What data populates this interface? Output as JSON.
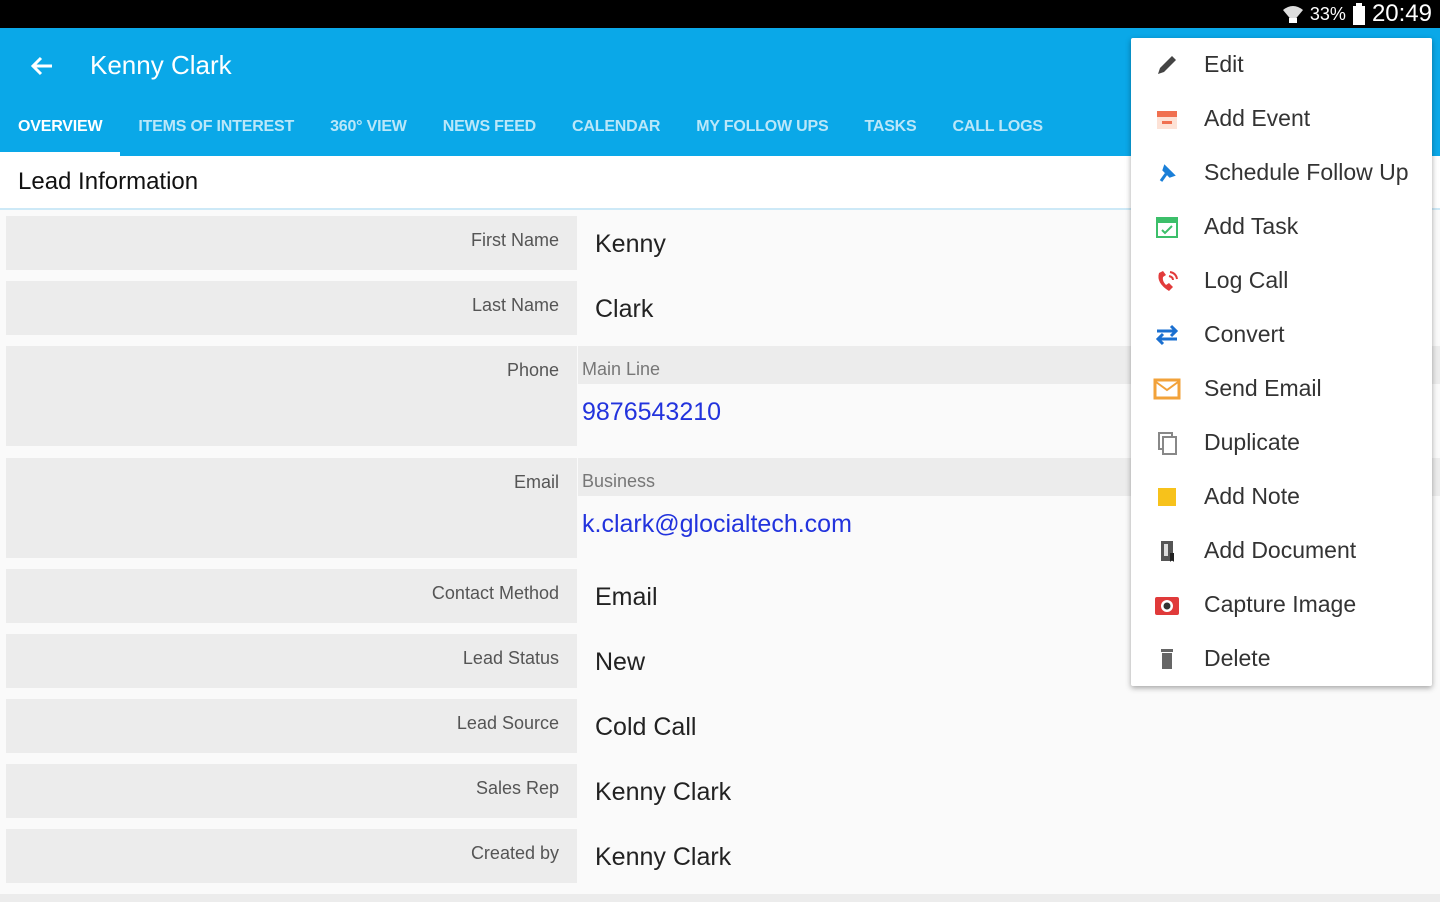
{
  "status": {
    "battery": "33%",
    "time": "20:49"
  },
  "header": {
    "title": "Kenny Clark"
  },
  "tabs": [
    {
      "label": "OVERVIEW"
    },
    {
      "label": "ITEMS OF INTEREST"
    },
    {
      "label": "360° VIEW"
    },
    {
      "label": "NEWS FEED"
    },
    {
      "label": "CALENDAR"
    },
    {
      "label": "MY FOLLOW UPS"
    },
    {
      "label": "TASKS"
    },
    {
      "label": "CALL LOGS"
    }
  ],
  "section": {
    "title": "Lead Information"
  },
  "fields": {
    "first_name": {
      "label": "First Name",
      "value": "Kenny"
    },
    "last_name": {
      "label": "Last Name",
      "value": "Clark"
    },
    "phone": {
      "label": "Phone",
      "type": "Main Line",
      "value": "9876543210"
    },
    "email": {
      "label": "Email",
      "type": "Business",
      "value": "k.clark@glocialtech.com"
    },
    "contact_method": {
      "label": "Contact Method",
      "value": "Email"
    },
    "lead_status": {
      "label": "Lead Status",
      "value": "New"
    },
    "lead_source": {
      "label": "Lead Source",
      "value": "Cold Call"
    },
    "sales_rep": {
      "label": "Sales Rep",
      "value": "Kenny Clark"
    },
    "created_by": {
      "label": "Created by",
      "value": "Kenny Clark"
    }
  },
  "menu": [
    {
      "label": "Edit",
      "icon": "pencil-icon"
    },
    {
      "label": "Add Event",
      "icon": "calendar-icon"
    },
    {
      "label": "Schedule Follow Up",
      "icon": "pin-icon"
    },
    {
      "label": "Add Task",
      "icon": "task-icon"
    },
    {
      "label": "Log Call",
      "icon": "phone-icon"
    },
    {
      "label": "Convert",
      "icon": "convert-icon"
    },
    {
      "label": "Send Email",
      "icon": "envelope-icon"
    },
    {
      "label": "Duplicate",
      "icon": "duplicate-icon"
    },
    {
      "label": "Add Note",
      "icon": "note-icon"
    },
    {
      "label": "Add Document",
      "icon": "document-icon"
    },
    {
      "label": "Capture Image",
      "icon": "camera-icon"
    },
    {
      "label": "Delete",
      "icon": "trash-icon"
    }
  ],
  "colors": {
    "primary": "#0aa8e8",
    "link": "#2233dd",
    "label_bg": "#ececec"
  }
}
